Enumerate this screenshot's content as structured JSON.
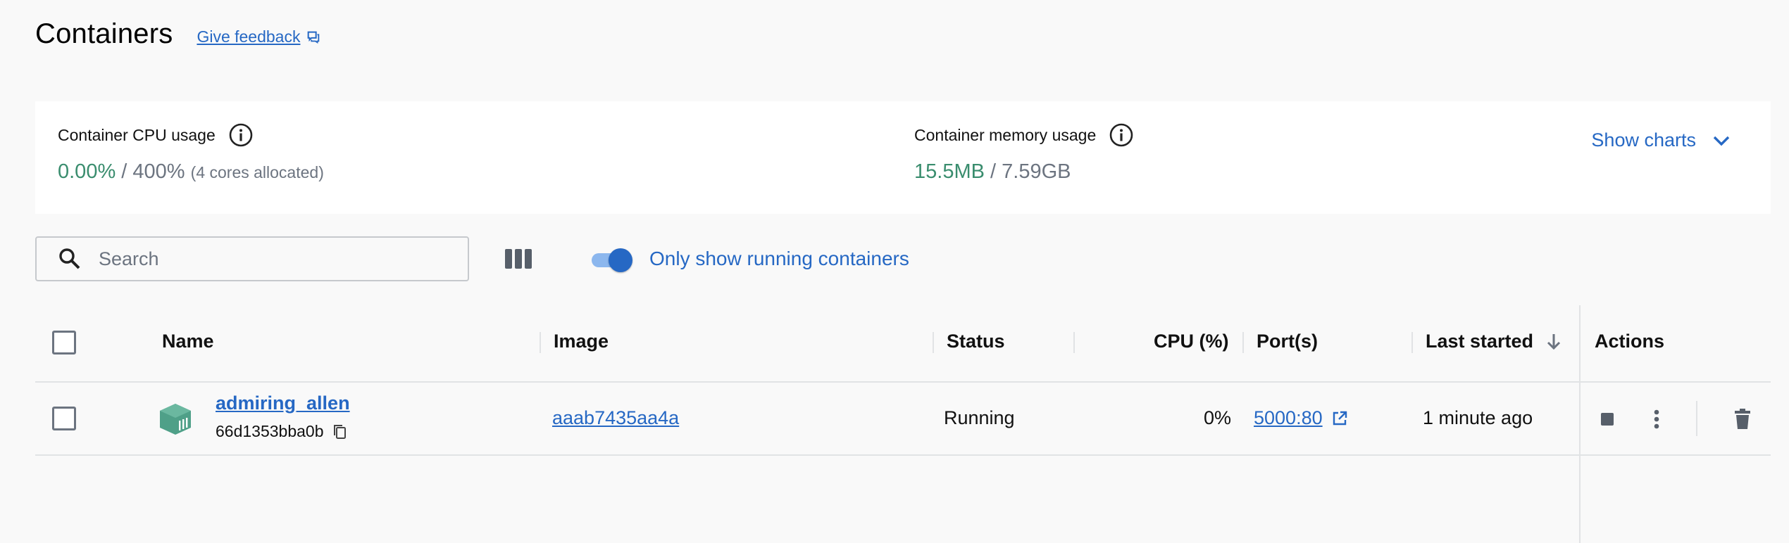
{
  "header": {
    "title": "Containers",
    "feedback_label": "Give feedback"
  },
  "usage": {
    "cpu": {
      "label": "Container CPU usage",
      "used": "0.00%",
      "separator": "/",
      "total": "400%",
      "note": "(4 cores allocated)"
    },
    "memory": {
      "label": "Container memory usage",
      "used": "15.5MB",
      "separator": "/",
      "total": "7.59GB"
    },
    "show_charts_label": "Show charts"
  },
  "toolbar": {
    "search_placeholder": "Search",
    "only_running_label": "Only show running containers",
    "only_running_enabled": true
  },
  "table": {
    "columns": {
      "name": "Name",
      "image": "Image",
      "status": "Status",
      "cpu": "CPU (%)",
      "ports": "Port(s)",
      "last_started": "Last started",
      "actions": "Actions"
    },
    "rows": [
      {
        "name": "admiring_allen",
        "id": "66d1353bba0b",
        "image": "aaab7435aa4a",
        "status": "Running",
        "cpu": "0%",
        "ports": "5000:80",
        "last_started": "1 minute ago"
      }
    ]
  },
  "colors": {
    "accent": "#2668c4",
    "usage_value": "#3a8d6e",
    "container_icon": "#4fa088"
  },
  "icons": [
    "external-window-icon",
    "info-icon",
    "chevron-down-icon",
    "search-icon",
    "columns-icon",
    "sort-down-arrow-icon",
    "container-icon",
    "copy-icon",
    "external-link-icon",
    "stop-icon",
    "more-vertical-icon",
    "trash-icon"
  ]
}
